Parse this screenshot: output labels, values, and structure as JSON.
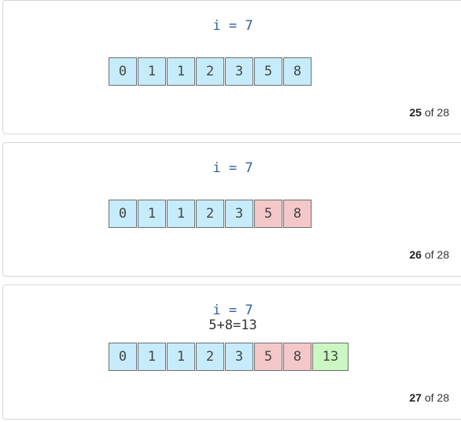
{
  "colors": {
    "default_cell": "#c6ecfb",
    "operand_cell": "#f4c8c8",
    "result_cell": "#caf7c2"
  },
  "slides": [
    {
      "index_label": "i = 7",
      "sum_label": "",
      "cells": [
        "0",
        "1",
        "1",
        "2",
        "3",
        "5",
        "8"
      ],
      "highlighted_operands": [],
      "result_index": null,
      "counter": {
        "current": "25",
        "of_text": "of 28"
      }
    },
    {
      "index_label": "i = 7",
      "sum_label": "",
      "cells": [
        "0",
        "1",
        "1",
        "2",
        "3",
        "5",
        "8"
      ],
      "highlighted_operands": [
        5,
        6
      ],
      "result_index": null,
      "counter": {
        "current": "26",
        "of_text": "of 28"
      }
    },
    {
      "index_label": "i = 7",
      "sum_label": "5+8=13",
      "cells": [
        "0",
        "1",
        "1",
        "2",
        "3",
        "5",
        "8",
        "13"
      ],
      "highlighted_operands": [
        5,
        6
      ],
      "result_index": 7,
      "counter": {
        "current": "27",
        "of_text": "of 28"
      }
    }
  ]
}
